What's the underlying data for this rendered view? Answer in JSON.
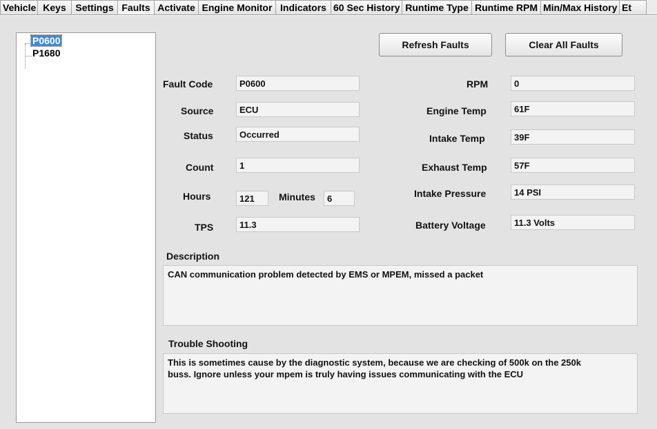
{
  "tabs": [
    "Vehicle",
    "Keys",
    "Settings",
    "Faults",
    "Activate",
    "Engine Monitor",
    "Indicators",
    "60 Sec History",
    "Runtime Type",
    "Runtime RPM",
    "Min/Max History",
    "Et"
  ],
  "active_tab": "Faults",
  "fault_list": [
    "P0600",
    "P1680"
  ],
  "buttons": {
    "refresh": "Refresh Faults",
    "clear": "Clear All Faults"
  },
  "left_fields": {
    "fault_code": {
      "label": "Fault Code",
      "value": "P0600"
    },
    "source": {
      "label": "Source",
      "value": "ECU"
    },
    "status": {
      "label": "Status",
      "value": "Occurred"
    },
    "count": {
      "label": "Count",
      "value": "1"
    },
    "hours": {
      "label": "Hours",
      "value": "121"
    },
    "minutes": {
      "label": "Minutes",
      "value": "6"
    },
    "tps": {
      "label": "TPS",
      "value": "11.3"
    }
  },
  "right_fields": {
    "rpm": {
      "label": "RPM",
      "value": "0"
    },
    "engine_temp": {
      "label": "Engine Temp",
      "value": "61F"
    },
    "intake_temp": {
      "label": "Intake Temp",
      "value": "39F"
    },
    "exhaust_temp": {
      "label": "Exhaust Temp",
      "value": "57F"
    },
    "intake_pressure": {
      "label": "Intake Pressure",
      "value": "14 PSI"
    },
    "battery_voltage": {
      "label": "Battery Voltage",
      "value": "11.3  Volts"
    }
  },
  "description": {
    "label": "Description",
    "text": "CAN communication problem detected by EMS or MPEM, missed a packet"
  },
  "trouble_shooting": {
    "label": "Trouble Shooting",
    "text": "This is sometimes cause by the diagnostic system, because we are checking of 500k on the 250k\nbuss. Ignore unless your mpem is truly having issues communicating with the ECU"
  }
}
